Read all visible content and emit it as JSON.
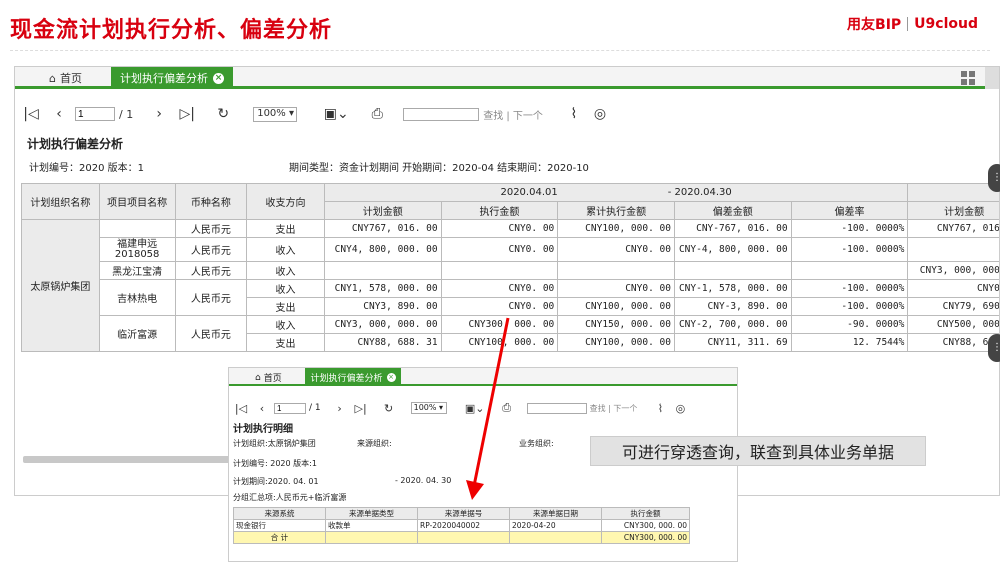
{
  "slide": {
    "title": "现金流计划执行分析、偏差分析",
    "brand_left": "用友BIP",
    "brand_right": "U9cloud"
  },
  "colors": {
    "brand_red": "#d8000f",
    "tab_green": "#3a9a2e",
    "callout_bg": "#e2e2e2",
    "total_row": "#fff7b0"
  },
  "main": {
    "tabs": {
      "home": "首页",
      "active": "计划执行偏差分析"
    },
    "toolbar": {
      "page_input": "1",
      "page_total": "/ 1",
      "zoom": "100%",
      "find": "查找 | 下一个"
    },
    "report_title": "计划执行偏差分析",
    "meta": {
      "left": "计划编号：2020  版本：1",
      "right": "期间类型：资金计划期间  开始期间：2020-04  结束期间：2020-10"
    },
    "period": {
      "start": "2020.04.01",
      "end": "- 2020.04.30"
    },
    "headers": {
      "org": "计划组织名称",
      "item": "项目项目名称",
      "currency": "币种名称",
      "direction": "收支方向",
      "plan": "计划金额",
      "exec": "执行金额",
      "cum_exec": "累计执行金额",
      "dev": "偏差金额",
      "rate": "偏差率",
      "plan2": "计划金额"
    },
    "org_name": "太原锅炉集团",
    "rows": [
      {
        "item": "",
        "currency": "人民币元",
        "dir": "支出",
        "plan": "CNY767, 016. 00",
        "exec": "CNY0. 00",
        "cum": "CNY100, 000. 00",
        "dev": "CNY-767, 016. 00",
        "rate": "-100. 0000%",
        "plan2": "CNY767, 016. 0"
      },
      {
        "item": "福建申远\n2018058",
        "currency": "人民币元",
        "dir": "收入",
        "plan": "CNY4, 800, 000. 00",
        "exec": "CNY0. 00",
        "cum": "CNY0. 00",
        "dev": "CNY-4, 800, 000. 00",
        "rate": "-100. 0000%",
        "plan2": ""
      },
      {
        "item": "黑龙江宝清",
        "currency": "人民币元",
        "dir": "收入",
        "plan": "",
        "exec": "",
        "cum": "",
        "dev": "",
        "rate": "",
        "plan2": "CNY3, 000, 000. 0"
      },
      {
        "item": "吉林热电",
        "currency": "人民币元",
        "dir": "收入",
        "plan": "CNY1, 578, 000. 00",
        "exec": "CNY0. 00",
        "cum": "CNY0. 00",
        "dev": "CNY-1, 578, 000. 00",
        "rate": "-100. 0000%",
        "plan2": "CNY0. 0"
      },
      {
        "item": "",
        "currency": "",
        "dir": "支出",
        "plan": "CNY3, 890. 00",
        "exec": "CNY0. 00",
        "cum": "CNY100, 000. 00",
        "dev": "CNY-3, 890. 00",
        "rate": "-100. 0000%",
        "plan2": "CNY79, 690. 0"
      },
      {
        "item": "临沂富源",
        "currency": "人民币元",
        "dir": "收入",
        "plan": "CNY3, 000, 000. 00",
        "exec": "CNY300, 000. 00",
        "cum": "CNY150, 000. 00",
        "dev": "CNY-2, 700, 000. 00",
        "rate": "-90. 0000%",
        "plan2": "CNY500, 000. 0"
      },
      {
        "item": "",
        "currency": "",
        "dir": "支出",
        "plan": "CNY88, 688. 31",
        "exec": "CNY100, 000. 00",
        "cum": "CNY100, 000. 00",
        "dev": "CNY11, 311. 69",
        "rate": "12. 7544%",
        "plan2": "CNY88, 688. 3"
      }
    ]
  },
  "inner": {
    "tabs": {
      "home": "首页",
      "active": "计划执行偏差分析"
    },
    "toolbar": {
      "page_input": "1",
      "page_total": "/ 1",
      "zoom": "100%",
      "find": "查找 | 下一个"
    },
    "title": "计划执行明细",
    "org": "计划组织:太原锅炉集团",
    "source_org": "来源组织:",
    "biz_org": "业务组织:",
    "plan_no": "计划编号: 2020  版本:1",
    "period": "计划期间:2020. 04. 01",
    "period_end": "- 2020. 04. 30",
    "group": "分组汇总项:人民币元+临沂富源",
    "headers": [
      "来源系统",
      "来源单据类型",
      "来源单据号",
      "来源单据日期",
      "执行金额"
    ],
    "rows": [
      [
        "现金银行",
        "收款单",
        "RP-2020040002",
        "2020-04-20",
        "CNY300, 000. 00"
      ]
    ],
    "total_label": "合 计",
    "total_value": "CNY300, 000. 00"
  },
  "callout": "可进行穿透查询，联查到具体业务单据"
}
